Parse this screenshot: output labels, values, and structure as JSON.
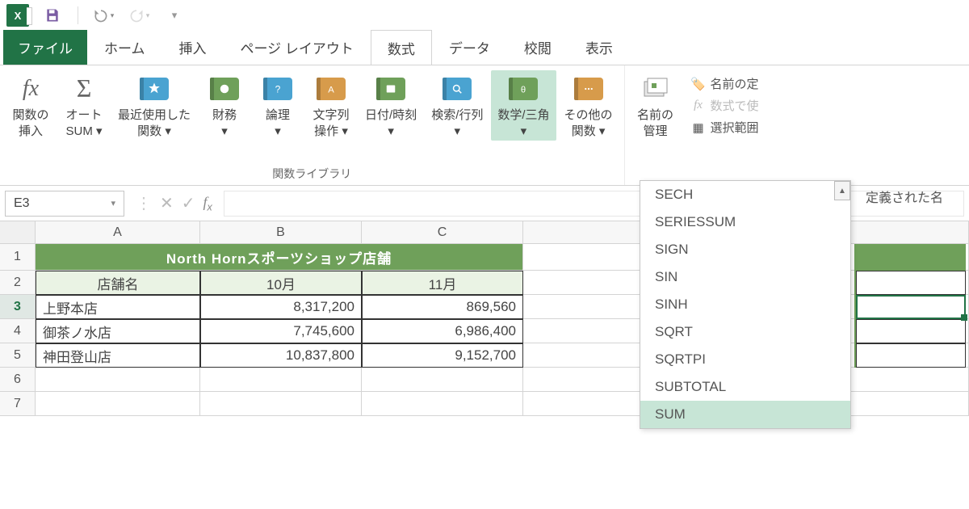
{
  "tabs": {
    "file": "ファイル",
    "home": "ホーム",
    "insert": "挿入",
    "pagelayout": "ページ レイアウト",
    "formulas": "数式",
    "data": "データ",
    "review": "校閲",
    "view": "表示"
  },
  "ribbon": {
    "insertfn": "関数の\n挿入",
    "autosum": "オート\nSUM ▾",
    "recent": "最近使用した\n関数 ▾",
    "financial": "財務\n▾",
    "logical": "論理\n▾",
    "text": "文字列\n操作 ▾",
    "datetime": "日付/時刻\n▾",
    "lookup": "検索/行列\n▾",
    "math": "数学/三角\n▾",
    "more": "その他の\n関数 ▾",
    "namemgr": "名前の\n管理",
    "group_label": "関数ライブラリ",
    "definename": "名前の定",
    "useinformula": "数式で使",
    "createfromsel": "選択範囲",
    "definednames": "定義された名"
  },
  "func_menu": [
    "SECH",
    "SERIESSUM",
    "SIGN",
    "SIN",
    "SINH",
    "SQRT",
    "SQRTPI",
    "SUBTOTAL",
    "SUM"
  ],
  "namebox": "E3",
  "cols": {
    "A": "A",
    "B": "B",
    "C": "C"
  },
  "rows": [
    "1",
    "2",
    "3",
    "4",
    "5",
    "6",
    "7"
  ],
  "table": {
    "title": "North Hornスポーツショップ店舗",
    "headers": {
      "store": "店舗名",
      "oct": "10月",
      "nov": "11月"
    },
    "data": [
      {
        "store": "上野本店",
        "oct": "8,317,200",
        "nov": "869,560"
      },
      {
        "store": "御茶ノ水店",
        "oct": "7,745,600",
        "nov": "6,986,400"
      },
      {
        "store": "神田登山店",
        "oct": "10,837,800",
        "nov": "9,152,700"
      }
    ]
  }
}
